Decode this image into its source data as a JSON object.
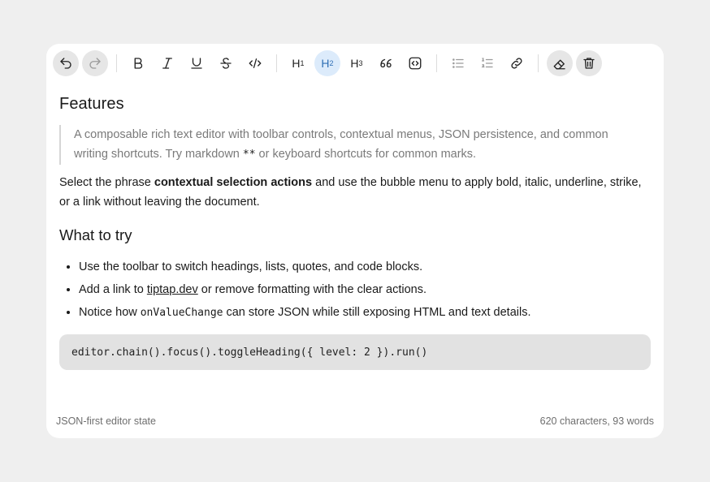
{
  "toolbar": {
    "buttons": [
      {
        "id": "undo",
        "icon": "undo-icon"
      },
      {
        "id": "redo",
        "icon": "redo-icon"
      },
      {
        "id": "bold",
        "icon": "bold-icon"
      },
      {
        "id": "italic",
        "icon": "italic-icon"
      },
      {
        "id": "underline",
        "icon": "underline-icon"
      },
      {
        "id": "strike",
        "icon": "strikethrough-icon"
      },
      {
        "id": "code",
        "icon": "code-icon"
      },
      {
        "id": "h1",
        "label": "H",
        "sub": "1"
      },
      {
        "id": "h2",
        "label": "H",
        "sub": "2",
        "active": true
      },
      {
        "id": "h3",
        "label": "H",
        "sub": "3"
      },
      {
        "id": "quote",
        "icon": "quote-icon"
      },
      {
        "id": "codeblock",
        "icon": "code-block-icon"
      },
      {
        "id": "bullet",
        "icon": "bullet-list-icon"
      },
      {
        "id": "ordered",
        "icon": "ordered-list-icon"
      },
      {
        "id": "link",
        "icon": "link-icon"
      },
      {
        "id": "clear",
        "icon": "eraser-icon"
      },
      {
        "id": "delete",
        "icon": "trash-icon"
      }
    ],
    "h1": {
      "label": "H",
      "sub": "1"
    },
    "h2": {
      "label": "H",
      "sub": "2"
    },
    "h3": {
      "label": "H",
      "sub": "3"
    },
    "active_color": "#dcebfb"
  },
  "doc": {
    "title": "Features",
    "quote_a": "A composable rich text editor with toolbar controls, contextual menus, JSON persistence, and common writing shortcuts. Try markdown",
    "quote_code": "**",
    "quote_b": "or keyboard shortcuts for common marks.",
    "para_a": "Select the phrase",
    "para_bold": "contextual selection actions",
    "para_b": "and use the bubble menu to apply bold, italic, underline, strike, or a link without leaving the document.",
    "subtitle": "What to try",
    "li1": "Use the toolbar to switch headings, lists, quotes, and code blocks.",
    "li2_a": "Add a link to",
    "li2_link": "tiptap.dev",
    "li2_b": "or remove formatting with the clear actions.",
    "li3_a": "Notice how",
    "li3_code": "onValueChange",
    "li3_b": "can store JSON while still exposing HTML and text details.",
    "code": "editor.chain().focus().toggleHeading({ level: 2 }).run()"
  },
  "footer": {
    "left": "JSON-first editor state",
    "right": "620 characters, 93 words"
  }
}
